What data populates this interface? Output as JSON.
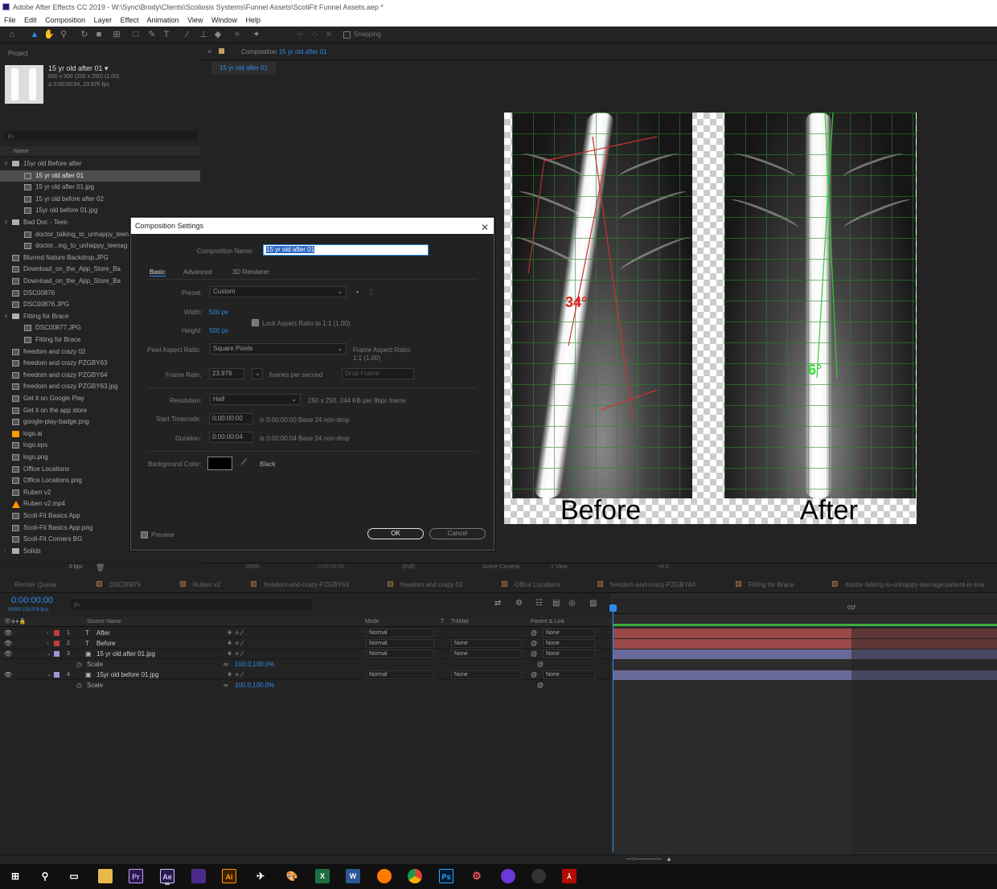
{
  "window": {
    "title": "Adobe After Effects CC 2019 - W:\\Sync\\Brody\\Clients\\Scoliosis Systems\\Funnel Assets\\ScoliFit Funnel Assets.aep *"
  },
  "menu": [
    "File",
    "Edit",
    "Composition",
    "Layer",
    "Effect",
    "Animation",
    "View",
    "Window",
    "Help"
  ],
  "toolbar": {
    "snapping_label": "Snapping"
  },
  "project": {
    "tab_label": "Project",
    "selected_name": "15 yr old after 01 ▾",
    "selected_info1": "500 x 500 (250 x 250) (1.00)",
    "selected_info2": "Δ 0:00:00:04, 23.976 fps",
    "search_placeholder": "ρᵥ",
    "column_name": "Name",
    "items": [
      {
        "name": "15yr old Before after",
        "type": "folder",
        "indent": 0,
        "twirl": "∨"
      },
      {
        "name": "15 yr old after 01",
        "type": "comp",
        "indent": 1,
        "selected": true
      },
      {
        "name": "15 yr old after 01.jpg",
        "type": "file",
        "indent": 1
      },
      {
        "name": "15 yr old before after 02",
        "type": "comp",
        "indent": 1
      },
      {
        "name": "15yr old before 01.jpg",
        "type": "file",
        "indent": 1
      },
      {
        "name": "Bad Doc - Teen",
        "type": "folder",
        "indent": 0,
        "twirl": "∨"
      },
      {
        "name": "doctor_talking_to_unhappy_teen",
        "type": "comp",
        "indent": 1
      },
      {
        "name": "doctor...ing_to_unhappy_teenag",
        "type": "file",
        "indent": 1
      },
      {
        "name": "Blurred Nature Backdrop.JPG",
        "type": "file",
        "indent": 0
      },
      {
        "name": "Download_on_the_App_Store_Ba",
        "type": "comp",
        "indent": 0
      },
      {
        "name": "Download_on_the_App_Store_Ba",
        "type": "comp",
        "indent": 0
      },
      {
        "name": "DSC00876",
        "type": "comp",
        "indent": 0
      },
      {
        "name": "DSC00876.JPG",
        "type": "file",
        "indent": 0
      },
      {
        "name": "Fitting for Brace",
        "type": "folder",
        "indent": 0,
        "twirl": "∨"
      },
      {
        "name": "DSC00877.JPG",
        "type": "file",
        "indent": 1
      },
      {
        "name": "Fitting for Brace",
        "type": "comp",
        "indent": 1
      },
      {
        "name": "freedom and crazy 02",
        "type": "comp",
        "indent": 0
      },
      {
        "name": "freedom and crazy PZGBY63",
        "type": "comp",
        "indent": 0
      },
      {
        "name": "freedom and crazy PZGBY64",
        "type": "comp",
        "indent": 0
      },
      {
        "name": "freedom and crazy PZGBY63.jpg",
        "type": "file",
        "indent": 0
      },
      {
        "name": "Get it on Google Play",
        "type": "comp",
        "indent": 0
      },
      {
        "name": "Get it on the app store",
        "type": "comp",
        "indent": 0
      },
      {
        "name": "google-play-badge.png",
        "type": "file",
        "indent": 0
      },
      {
        "name": "logo.ai",
        "type": "ai",
        "indent": 0
      },
      {
        "name": "logo.eps",
        "type": "file",
        "indent": 0
      },
      {
        "name": "logo.png",
        "type": "file",
        "indent": 0
      },
      {
        "name": "Office Locations",
        "type": "comp",
        "indent": 0
      },
      {
        "name": "Office Locations.png",
        "type": "file",
        "indent": 0
      },
      {
        "name": "Ruben v2",
        "type": "comp",
        "indent": 0
      },
      {
        "name": "Ruben v2.mp4",
        "type": "mp4",
        "indent": 0
      },
      {
        "name": "Scoli-Fit Basics App",
        "type": "comp",
        "indent": 0
      },
      {
        "name": "Scoli-Fit Basics App.png",
        "type": "file",
        "indent": 0
      },
      {
        "name": "Scoli-Fit Corners BG",
        "type": "comp",
        "indent": 0
      },
      {
        "name": "Solids",
        "type": "folder",
        "indent": 0,
        "twirl": "›"
      }
    ],
    "bpc_label": "8 bpc"
  },
  "composition": {
    "panel_prefix": "Composition",
    "panel_comp": "15 yr old after 01",
    "breadcrumb": "15 yr old after 01",
    "before_label": "Before",
    "after_label": "After",
    "before_angle": "34°",
    "after_angle": "6°",
    "zoom_label": "200%",
    "timecode": "0:00:00:00",
    "resolution": "(Full)",
    "camera": "Active Camera",
    "view": "1 View",
    "exposure": "+0.0"
  },
  "dialog": {
    "title": "Composition Settings",
    "name_label": "Composition Name:",
    "name_value": "15 yr old after 01",
    "tabs": [
      "Basic",
      "Advanced",
      "3D Renderer"
    ],
    "preset_label": "Preset:",
    "preset_value": "Custom",
    "width_label": "Width:",
    "width_value": "500 px",
    "height_label": "Height:",
    "height_value": "500 px",
    "lock_label": "Lock Aspect Ratio to 1:1 (1.00)",
    "par_label": "Pixel Aspect Ratio:",
    "par_value": "Square Pixels",
    "far_label": "Frame Aspect Ratio:",
    "far_value": "1:1 (1.00)",
    "fr_label": "Frame Rate:",
    "fr_value": "23.976",
    "fps_label": "frames per second",
    "drop_frame": "Drop Frame",
    "res_label": "Resolution:",
    "res_value": "Half",
    "res_info": "250 x 250, 244 KB per 8bpc frame",
    "start_label": "Start Timecode:",
    "start_value": "0:00:00:00",
    "start_info": "is 0:00:00:00  Base 24  non-drop",
    "dur_label": "Duration:",
    "dur_value": "0:00:00:04",
    "dur_info": "is 0:00:00:04  Base 24  non-drop",
    "bg_label": "Background Color:",
    "bg_name": "Black",
    "preview_label": "Preview",
    "ok_label": "OK",
    "cancel_label": "Cancel"
  },
  "timeline": {
    "tabs": [
      "Render Queue",
      "DSC00876",
      "Ruben v2",
      "freedom-and-crazy-PZGBY63",
      "freedom and crazy 02",
      "Office Locations",
      "freedom-and-crazy-PZGBY64",
      "Fitting for Brace",
      "doctor-talking-to-unhappy-teenage-patient-in-exa"
    ],
    "timecode": "0:00:00:00",
    "fps": "00000 (23.976 fps)",
    "search_placeholder": "ρᵥ",
    "col_source": "Source Name",
    "col_mode": "Mode",
    "col_t": "T",
    "col_trkmat": "TrkMat",
    "col_parent": "Parent & Link",
    "ruler_end": "01f",
    "layers": [
      {
        "num": "1",
        "name": "After",
        "kind": "T",
        "color": "#c43a3a",
        "mode": "Normal",
        "trkmat": "",
        "parent": "None"
      },
      {
        "num": "2",
        "name": "Before",
        "kind": "T",
        "color": "#c43a3a",
        "mode": "Normal",
        "trkmat": "None",
        "parent": "None"
      },
      {
        "num": "3",
        "name": "15 yr old after 01.jpg",
        "kind": "img",
        "color": "#9a9ad8",
        "mode": "Normal",
        "trkmat": "None",
        "parent": "None",
        "prop": "Scale",
        "prop_value": "100.0,100.0%"
      },
      {
        "num": "4",
        "name": "15yr old before 01.jpg",
        "kind": "img",
        "color": "#9a9ad8",
        "mode": "Normal",
        "trkmat": "None",
        "parent": "None",
        "prop": "Scale",
        "prop_value": "100.0,100.0%"
      }
    ]
  },
  "taskbar": {
    "apps": [
      {
        "name": "Pr",
        "color": "#2a1a4a",
        "fg": "#c99cff"
      },
      {
        "name": "Ae",
        "color": "#2a1a4a",
        "fg": "#c9c9ff"
      },
      {
        "name": "",
        "color": "#4a2a8a",
        "fg": "#ffffff"
      },
      {
        "name": "Ai",
        "color": "#3a2000",
        "fg": "#ff9a00"
      },
      {
        "name": "Ps",
        "color": "#001a33",
        "fg": "#31a8ff"
      }
    ]
  }
}
